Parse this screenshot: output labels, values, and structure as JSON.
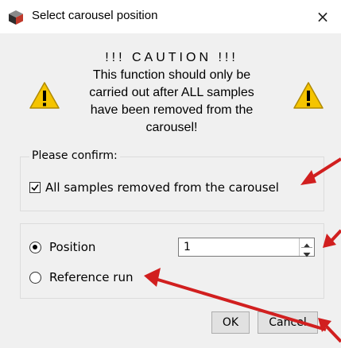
{
  "window": {
    "title": "Select carousel position",
    "close_glyph": "×",
    "app_icon": "cube-icon"
  },
  "caution": {
    "title": "!!! CAUTION !!!",
    "lines": [
      "This function should only be",
      "carried out after ALL samples",
      "have been removed from the",
      "carousel!"
    ],
    "icon": "warning-icon"
  },
  "confirm": {
    "group_label": "Please confirm:",
    "checkbox_label": "All samples removed from the carousel",
    "checked": true
  },
  "mode": {
    "position_label": "Position",
    "position_selected": true,
    "reference_label": "Reference run",
    "reference_selected": false,
    "position_value": "1"
  },
  "buttons": {
    "ok": "OK",
    "cancel": "Cancel"
  },
  "colors": {
    "dialog_bg": "#f0f0f0",
    "annotation_arrow": "#d11f1f",
    "warning_yellow": "#f5c400"
  }
}
